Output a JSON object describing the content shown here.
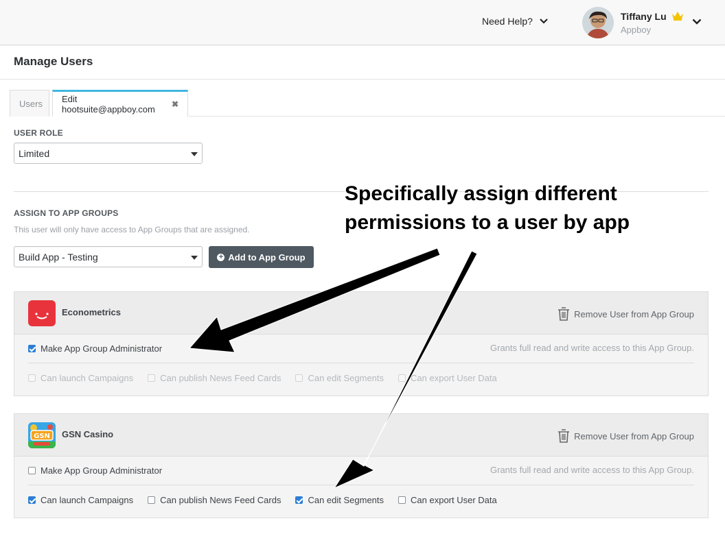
{
  "header": {
    "help_label": "Need Help?",
    "user_name": "Tiffany Lu",
    "user_org": "Appboy",
    "accent_crown": "#f3c300"
  },
  "page": {
    "title": "Manage Users"
  },
  "tabs": [
    {
      "label": "Users",
      "active": false
    },
    {
      "label": "Edit hootsuite@appboy.com",
      "active": true
    }
  ],
  "user_role": {
    "label": "USER ROLE",
    "value": "Limited"
  },
  "assign": {
    "label": "ASSIGN TO APP GROUPS",
    "help": "This user will only have access to App Groups that are assigned.",
    "select_value": "Build App - Testing",
    "add_button": "Add to App Group"
  },
  "app_groups": [
    {
      "name": "Econometrics",
      "icon": "econometrics-app-icon",
      "remove_label": "Remove User from App Group",
      "admin_label": "Make App Group Administrator",
      "admin_checked": true,
      "grants_text": "Grants full read and write access to this App Group.",
      "permissions": [
        {
          "label": "Can launch Campaigns",
          "checked": false
        },
        {
          "label": "Can publish News Feed Cards",
          "checked": false
        },
        {
          "label": "Can edit Segments",
          "checked": false
        },
        {
          "label": "Can export User Data",
          "checked": false
        }
      ]
    },
    {
      "name": "GSN Casino",
      "icon": "gsn-casino-app-icon",
      "icon_text": "GSN",
      "remove_label": "Remove User from App Group",
      "admin_label": "Make App Group Administrator",
      "admin_checked": false,
      "grants_text": "Grants full read and write access to this App Group.",
      "permissions": [
        {
          "label": "Can launch Campaigns",
          "checked": true
        },
        {
          "label": "Can publish News Feed Cards",
          "checked": false
        },
        {
          "label": "Can edit Segments",
          "checked": true
        },
        {
          "label": "Can export User Data",
          "checked": false
        }
      ]
    }
  ],
  "annotation": {
    "line1": "Specifically assign different",
    "line2": "permissions to a user by app"
  },
  "colors": {
    "tab_accent": "#3fb6e0",
    "checkbox": "#2b7fd4",
    "button": "#4f5962",
    "econometrics_icon": "#e8333c"
  }
}
